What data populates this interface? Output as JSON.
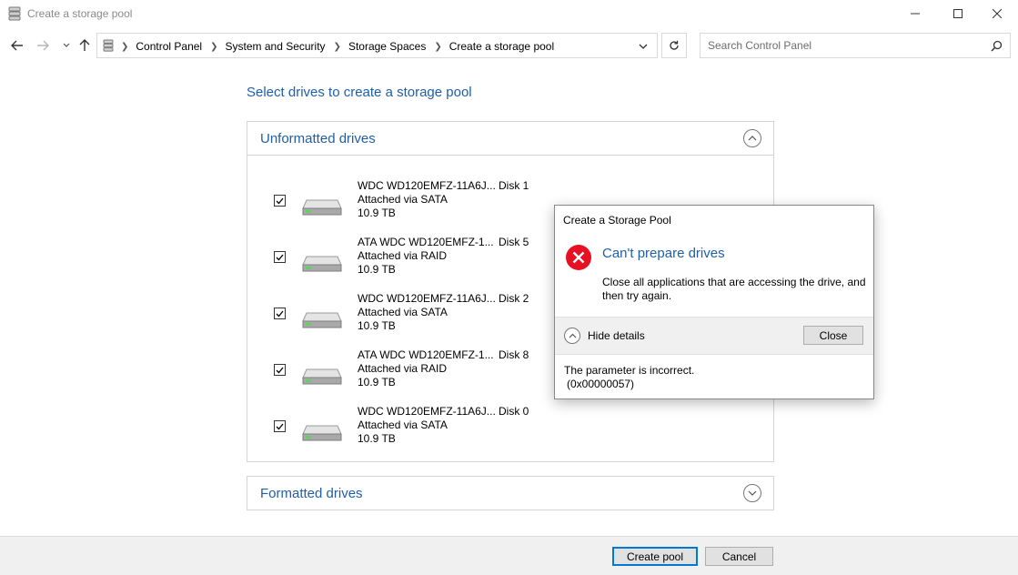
{
  "window": {
    "title": "Create a storage pool",
    "minimize_icon": "minimize-icon",
    "maximize_icon": "maximize-icon",
    "close_icon": "close-icon"
  },
  "nav": {
    "breadcrumbs": [
      "Control Panel",
      "System and Security",
      "Storage Spaces",
      "Create a storage pool"
    ],
    "search_placeholder": "Search Control Panel"
  },
  "main": {
    "heading": "Select drives to create a storage pool",
    "unformatted": {
      "title": "Unformatted drives",
      "drives": [
        {
          "name": "WDC WD120EMFZ-11A6J...",
          "conn": "Attached via SATA",
          "size": "10.9 TB",
          "disk": "Disk 1",
          "checked": true
        },
        {
          "name": "ATA WDC WD120EMFZ-1...",
          "conn": "Attached via RAID",
          "size": "10.9 TB",
          "disk": "Disk 5",
          "checked": true
        },
        {
          "name": "WDC WD120EMFZ-11A6J...",
          "conn": "Attached via SATA",
          "size": "10.9 TB",
          "disk": "Disk 2",
          "checked": true
        },
        {
          "name": "ATA WDC WD120EMFZ-1...",
          "conn": "Attached via RAID",
          "size": "10.9 TB",
          "disk": "Disk 8",
          "checked": true
        },
        {
          "name": "WDC WD120EMFZ-11A6J...",
          "conn": "Attached via SATA",
          "size": "10.9 TB",
          "disk": "Disk 0",
          "checked": true
        }
      ]
    },
    "formatted": {
      "title": "Formatted drives"
    }
  },
  "footer": {
    "create_label": "Create pool",
    "cancel_label": "Cancel"
  },
  "dialog": {
    "title": "Create a Storage Pool",
    "heading": "Can't prepare drives",
    "message": "Close all applications that are accessing the drive, and then try again.",
    "hide_details": "Hide details",
    "close_label": "Close",
    "detail_line1": "The parameter is incorrect.",
    "detail_line2": "(0x00000057)"
  },
  "colors": {
    "accent_text": "#1e5fa8",
    "error_red": "#e81123",
    "default_button_border": "#0078d7"
  }
}
